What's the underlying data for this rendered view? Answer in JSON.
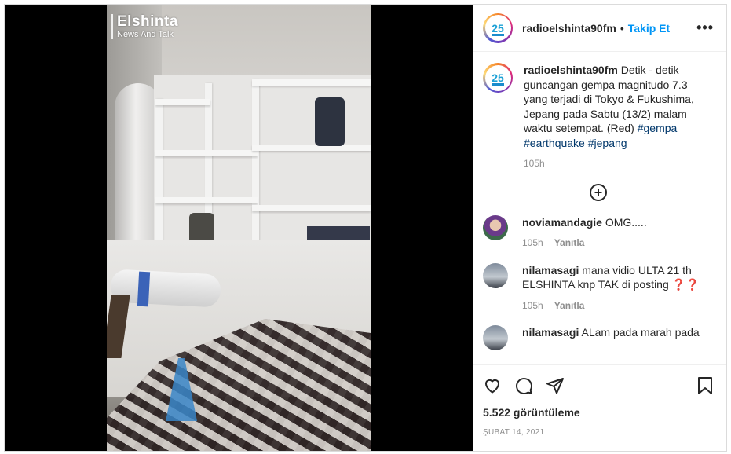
{
  "media": {
    "watermark_title": "Elshinta",
    "watermark_subtitle": "News And Talk"
  },
  "header": {
    "username": "radioelshinta90fm",
    "separator": "•",
    "follow_label": "Takip Et",
    "more_label": "•••",
    "avatar_text": "25"
  },
  "caption": {
    "username": "radioelshinta90fm",
    "text": "Detik - detik guncangan gempa magnitudo 7.3 yang terjadi di Tokyo & Fukushima, Jepang pada Sabtu (13/2) malam waktu setempat. (Red)",
    "tags": [
      "#gempa",
      "#earthquake",
      "#jepang"
    ],
    "time": "105h"
  },
  "load_more_label": "+",
  "comments": [
    {
      "username": "noviamandagie",
      "text": "OMG.....",
      "time": "105h",
      "reply_label": "Yanıtla"
    },
    {
      "username": "nilamasagi",
      "text": "mana vidio ULTA 21 th ELSHINTA knp TAK di posting ❓❓",
      "time": "105h",
      "reply_label": "Yanıtla"
    },
    {
      "username": "nilamasagi",
      "text": "ALam pada marah pada",
      "time": "",
      "reply_label": ""
    }
  ],
  "footer": {
    "views": "5.522 görüntüleme",
    "date": "ŞUBAT 14, 2021"
  },
  "icons": {
    "like": "heart-icon",
    "comment": "comment-icon",
    "share": "share-icon",
    "save": "bookmark-icon"
  }
}
